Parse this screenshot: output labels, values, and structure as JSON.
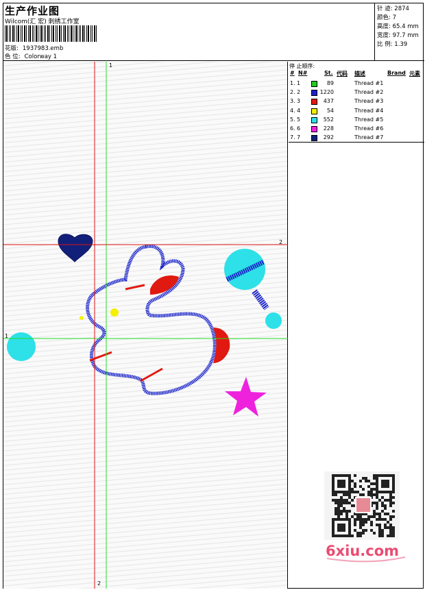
{
  "header": {
    "title": "生产作业图",
    "studio": "Wilcom(汇 宏) 刺绣工作室",
    "design_label": "花版:",
    "design_value": "1937983.emb",
    "colorway_label": "色 位:",
    "colorway_value": "Colorway 1"
  },
  "stats": [
    {
      "label": "针 迹:",
      "value": "2874"
    },
    {
      "label": "颜色:",
      "value": "7"
    },
    {
      "label": "高度:",
      "value": "65.4 mm"
    },
    {
      "label": "宽度:",
      "value": "97.7 mm"
    },
    {
      "label": "比 例:",
      "value": "1.39"
    }
  ],
  "guides": {
    "green_v_label": "1",
    "green_h_label": "1",
    "red_h_label": "2",
    "red_v_label": "2"
  },
  "threads": {
    "stop_title": "停 止顺序:",
    "headers": {
      "num": "#",
      "n": "N#",
      "st": "St.",
      "code": "代码",
      "desc": "描述",
      "brand": "Brand",
      "elem": "元素"
    },
    "rows": [
      {
        "num": "1.",
        "n": "1",
        "st": "89",
        "color": "#22cc22",
        "desc": "Thread #1"
      },
      {
        "num": "2.",
        "n": "2",
        "st": "1220",
        "color": "#1a23c8",
        "desc": "Thread #2"
      },
      {
        "num": "3.",
        "n": "3",
        "st": "437",
        "color": "#e01a10",
        "desc": "Thread #3"
      },
      {
        "num": "4.",
        "n": "4",
        "st": "54",
        "color": "#f4f000",
        "desc": "Thread #4"
      },
      {
        "num": "5.",
        "n": "5",
        "st": "552",
        "color": "#2ee0e8",
        "desc": "Thread #5"
      },
      {
        "num": "6.",
        "n": "6",
        "st": "228",
        "color": "#ee22dd",
        "desc": "Thread #6"
      },
      {
        "num": "7.",
        "n": "7",
        "st": "292",
        "color": "#12207a",
        "desc": "Thread #7"
      }
    ]
  },
  "logo": {
    "text": "6xiu.com",
    "color": "#e94c72"
  },
  "colors": {
    "guide_green": "#22dd22",
    "guide_red": "#dd1111"
  }
}
